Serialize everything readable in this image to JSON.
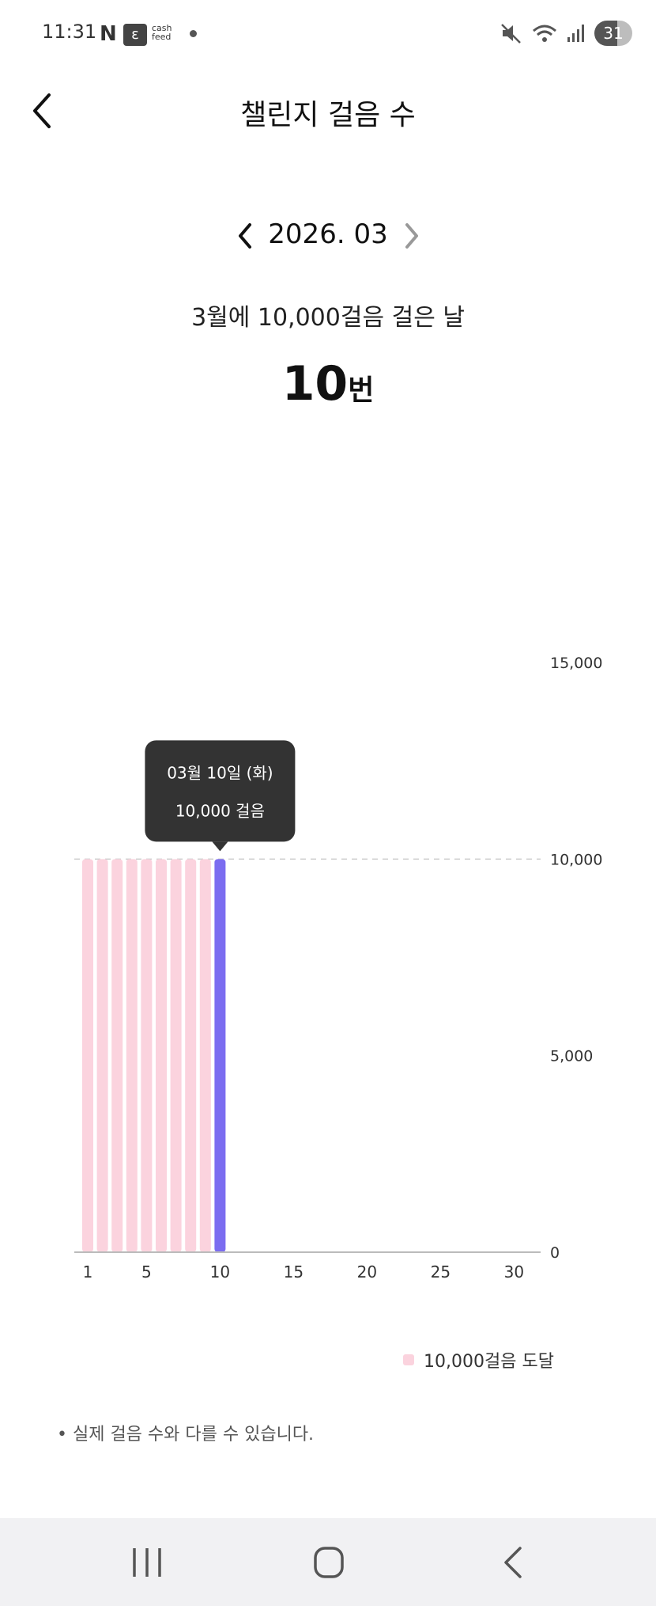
{
  "status": {
    "time": "11:31",
    "n_icon": "N",
    "cash_icon": "ɛ",
    "cash_text": "cash feed",
    "battery": "31",
    "icons": [
      "mute-icon",
      "wifi-icon",
      "signal-icon",
      "battery-icon"
    ]
  },
  "header": {
    "title": "챌린지 걸음 수",
    "back_icon": "chevron-left-icon"
  },
  "month": {
    "label": "2026. 03",
    "prev_icon": "chevron-left-icon",
    "next_icon": "chevron-right-icon"
  },
  "summary": {
    "text": "3월에 10,000걸음 걸은 날",
    "count": "10",
    "unit": "번"
  },
  "chart_data": {
    "type": "bar",
    "x": [
      1,
      2,
      3,
      4,
      5,
      6,
      7,
      8,
      9,
      10
    ],
    "values": [
      10000,
      10000,
      10000,
      10000,
      10000,
      10000,
      10000,
      10000,
      10000,
      10000
    ],
    "x_range": [
      1,
      31
    ],
    "x_ticks": [
      "1",
      "5",
      "10",
      "15",
      "20",
      "25",
      "30"
    ],
    "y_ticks": [
      "0",
      "5,000",
      "10,000",
      "15,000"
    ],
    "ylim": [
      0,
      15000
    ],
    "target": 10000,
    "selected_day": 10,
    "colors": {
      "bar": "#fbd3de",
      "selected": "#7b6cf0",
      "tooltip": "#333333"
    },
    "tooltip": {
      "date": "03월 10일 (화)",
      "value": "10,000 걸음"
    },
    "legend": {
      "label": "10,000걸음 도달",
      "position": "bottom-right"
    }
  },
  "footnote": "• 실제 걸음 수와 다를 수 있습니다.",
  "navbar": {
    "icons": [
      "recents-icon",
      "home-icon",
      "back-icon"
    ]
  }
}
